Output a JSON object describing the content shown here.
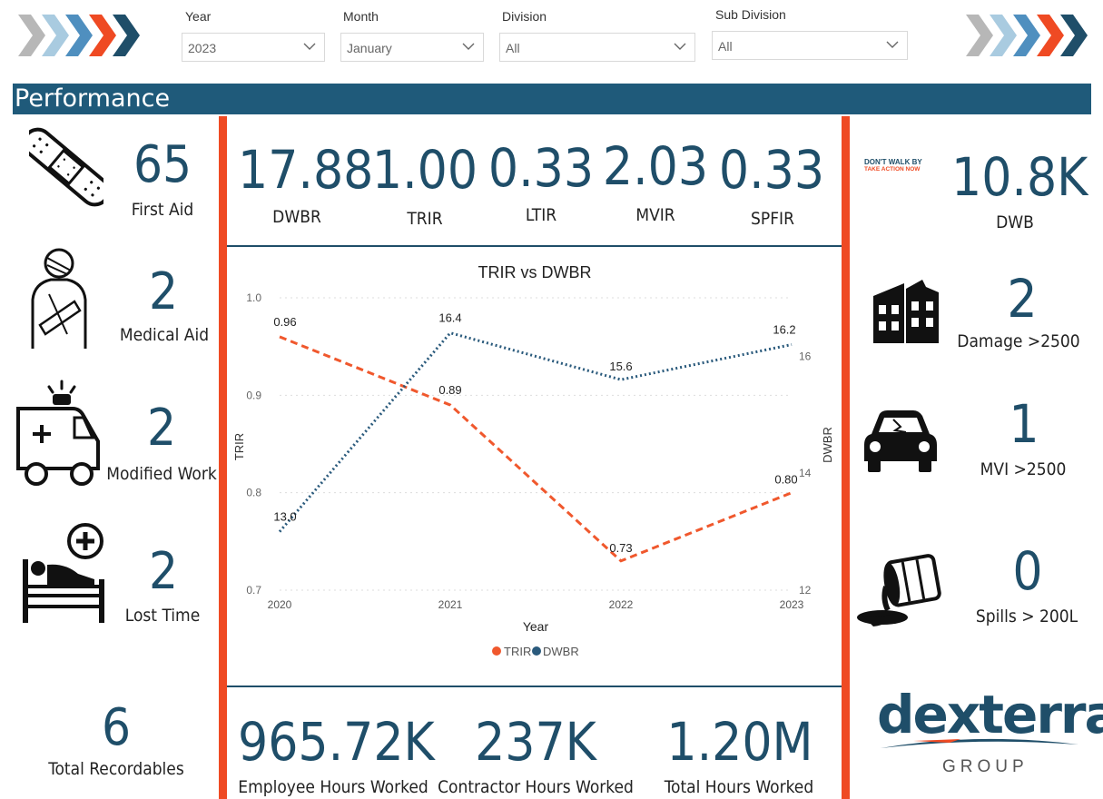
{
  "filters": {
    "year": {
      "label": "Year",
      "value": "2023"
    },
    "month": {
      "label": "Month",
      "value": "January"
    },
    "division": {
      "label": "Division",
      "value": "All"
    },
    "subdivision": {
      "label": "Sub Division",
      "value": "All"
    }
  },
  "header": {
    "title": "Performance"
  },
  "left_metrics": [
    {
      "value": "65",
      "label": "First Aid",
      "icon": "bandage-icon"
    },
    {
      "value": "2",
      "label": "Medical Aid",
      "icon": "injured-person-icon"
    },
    {
      "value": "2",
      "label": "Modified Work",
      "icon": "ambulance-icon"
    },
    {
      "value": "2",
      "label": "Lost Time",
      "icon": "hospital-bed-icon"
    },
    {
      "value": "6",
      "label": "Total Recordables"
    }
  ],
  "rates": [
    {
      "value": "17.88",
      "label": "DWBR"
    },
    {
      "value": "1.00",
      "label": "TRIR"
    },
    {
      "value": "0.33",
      "label": "LTIR"
    },
    {
      "value": "2.03",
      "label": "MVIR"
    },
    {
      "value": "0.33",
      "label": "SPFIR"
    }
  ],
  "right_metrics": [
    {
      "value": "10.8K",
      "label": "DWB",
      "icon": "dont-walk-by-logo",
      "logo_line1": "DON'T WALK BY",
      "logo_line2": "TAKE ACTION NOW"
    },
    {
      "value": "2",
      "label": "Damage >2500",
      "icon": "building-damage-icon"
    },
    {
      "value": "1",
      "label": "MVI >2500",
      "icon": "car-crash-icon"
    },
    {
      "value": "0",
      "label": "Spills > 200L",
      "icon": "barrel-spill-icon"
    }
  ],
  "hours": [
    {
      "value": "965.72K",
      "label": "Employee Hours Worked"
    },
    {
      "value": "237K",
      "label": "Contractor Hours Worked"
    },
    {
      "value": "1.20M",
      "label": "Total Hours Worked"
    }
  ],
  "brand": {
    "name_part1": "dex",
    "name_part2": "terra",
    "sub": "GROUP"
  },
  "colors": {
    "accent": "#ef4a23",
    "navy": "#1f4e69",
    "banner": "#1f5a7a",
    "trir": "#f0582d",
    "dwbr": "#2a5a7c"
  },
  "chart_data": {
    "type": "line",
    "title": "TRIR vs DWBR",
    "xlabel": "Year",
    "ylabel": "TRIR",
    "y2label": "DWBR",
    "categories": [
      "2020",
      "2021",
      "2022",
      "2023"
    ],
    "series": [
      {
        "name": "TRIR",
        "axis": "left",
        "values": [
          0.96,
          0.89,
          0.73,
          0.8
        ],
        "labels": [
          "0.96",
          "0.89",
          "0.73",
          "0.80"
        ],
        "style": "dashed"
      },
      {
        "name": "DWBR",
        "axis": "right",
        "values": [
          13.0,
          16.4,
          15.6,
          16.2
        ],
        "labels": [
          "13.0",
          "16.4",
          "15.6",
          "16.2"
        ],
        "style": "dotted"
      }
    ],
    "ylim": [
      0.7,
      1.0
    ],
    "yticks": [
      "0.7",
      "0.8",
      "0.9",
      "1.0"
    ],
    "y2lim": [
      12,
      17
    ],
    "y2ticks": [
      "12",
      "14",
      "16"
    ],
    "legend": "bottom",
    "grid": true
  }
}
